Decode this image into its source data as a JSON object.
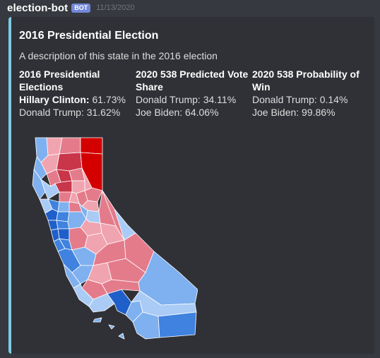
{
  "message": {
    "username": "election-bot",
    "bot_tag": "BOT",
    "timestamp": "11/13/2020"
  },
  "embed": {
    "accent_color": "#7fc9e6",
    "title": "2016 Presidential Election",
    "description": "A description of this state in the 2016 election",
    "fields": [
      {
        "name": "2016 Presidential Elections",
        "line1_bold": "Hillary Clinton:",
        "line1_rest": " 61.73%",
        "line2": "Donald Trump: 31.62%"
      },
      {
        "name": "2020 538 Predicted Vote Share",
        "line1": "Donald Trump: 34.11%",
        "line2": "Joe Biden: 64.06%"
      },
      {
        "name": "2020 538 Probability of Win",
        "line1": "Donald Trump: 0.14%",
        "line2": "Joe Biden: 99.86%"
      }
    ],
    "map": {
      "icon": "california-county-map",
      "colors": {
        "dark_red": "#d40000",
        "red": "#c9364a",
        "light_red": "#e47b8b",
        "pale_red": "#f0a4b0",
        "dark_blue": "#1f5fc9",
        "blue": "#3f82df",
        "light_blue": "#7fb0ef",
        "pale_blue": "#a9cbf5",
        "outline": "#ffffff"
      }
    }
  }
}
